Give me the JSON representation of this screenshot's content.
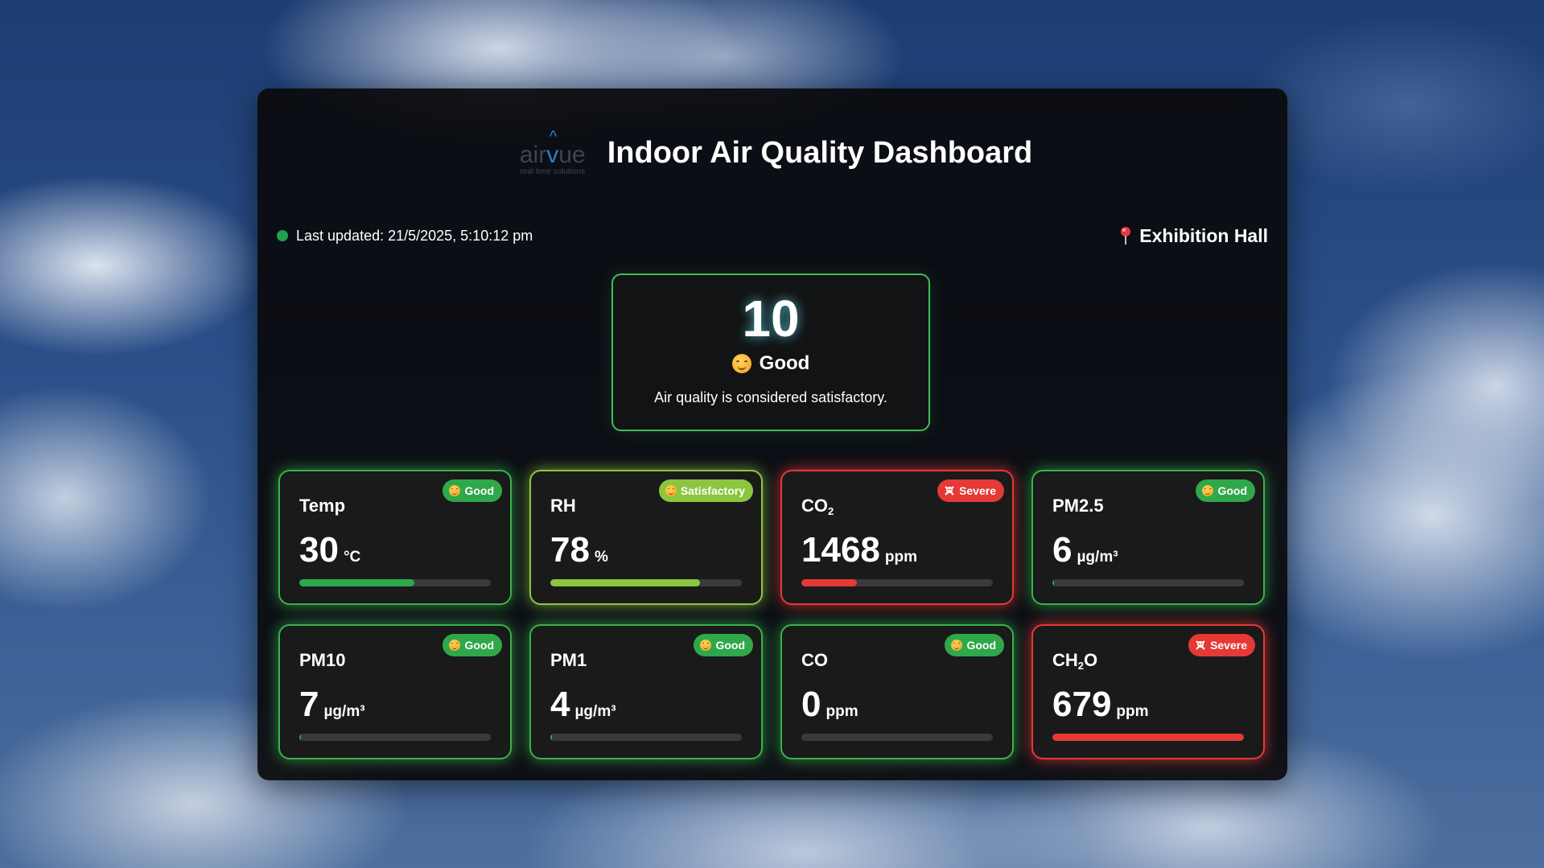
{
  "logo": {
    "word_prefix": "air",
    "word_accent": "v",
    "word_suffix": "ue",
    "tagline": "real time solutions"
  },
  "header": {
    "title": "Indoor Air Quality Dashboard"
  },
  "status": {
    "last_updated": "Last updated: 21/5/2025, 5:10:12 pm",
    "live_color": "#20a050"
  },
  "location": {
    "icon": "pin-icon",
    "name": "Exhibition Hall"
  },
  "aqi": {
    "value": "10",
    "category": "Good",
    "category_icon": "smiley-face-icon",
    "description": "Air quality is considered satisfactory.",
    "accent_color": "#3fbf5a"
  },
  "colors": {
    "good": "#2ea84a",
    "satisfactory": "#8cc63f",
    "severe": "#e53935"
  },
  "metrics": [
    {
      "name": "Temp",
      "sub": "",
      "name_suffix": "",
      "value": "30",
      "unit": "°C",
      "status": "Good",
      "level": "good",
      "status_icon": "smiley-face-icon",
      "progress": 0.6
    },
    {
      "name": "RH",
      "sub": "",
      "name_suffix": "",
      "value": "78",
      "unit": "%",
      "status": "Satisfactory",
      "level": "sat",
      "status_icon": "smiley-face-icon",
      "progress": 0.78
    },
    {
      "name": "CO",
      "sub": "2",
      "name_suffix": "",
      "value": "1468",
      "unit": "ppm",
      "status": "Severe",
      "level": "severe",
      "status_icon": "skull-icon",
      "progress": 0.29
    },
    {
      "name": "PM2.5",
      "sub": "",
      "name_suffix": "",
      "value": "6",
      "unit": "µg/m³",
      "status": "Good",
      "level": "good",
      "status_icon": "smiley-face-icon",
      "progress": 0.01
    },
    {
      "name": "PM10",
      "sub": "",
      "name_suffix": "",
      "value": "7",
      "unit": "µg/m³",
      "status": "Good",
      "level": "good",
      "status_icon": "smiley-face-icon",
      "progress": 0.01
    },
    {
      "name": "PM1",
      "sub": "",
      "name_suffix": "",
      "value": "4",
      "unit": "µg/m³",
      "status": "Good",
      "level": "good",
      "status_icon": "smiley-face-icon",
      "progress": 0.01
    },
    {
      "name": "CO",
      "sub": "",
      "name_suffix": "",
      "value": "0",
      "unit": "ppm",
      "status": "Good",
      "level": "good",
      "status_icon": "smiley-face-icon",
      "progress": 0
    },
    {
      "name": "CH",
      "sub": "2",
      "name_suffix": "O",
      "value": "679",
      "unit": "ppm",
      "status": "Severe",
      "level": "severe",
      "status_icon": "skull-icon",
      "progress": 1.0
    }
  ]
}
